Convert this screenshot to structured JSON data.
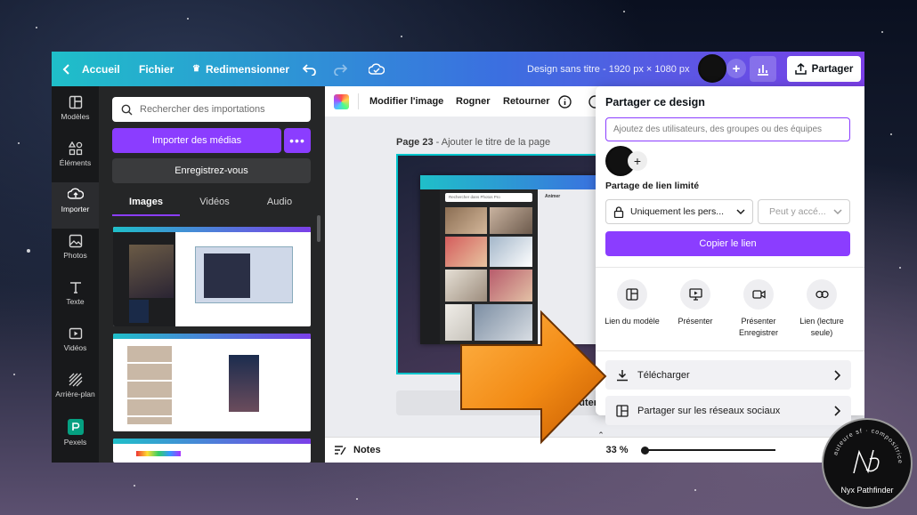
{
  "topbar": {
    "home_label": "Accueil",
    "file_label": "Fichier",
    "resize_label": "Redimensionner",
    "design_title": "Design sans titre - 1920 px × 1080 px",
    "share_label": "Partager"
  },
  "sidebar": {
    "items": [
      {
        "label": "Modèles",
        "icon": "templates-icon"
      },
      {
        "label": "Éléments",
        "icon": "elements-icon"
      },
      {
        "label": "Importer",
        "icon": "upload-icon"
      },
      {
        "label": "Photos",
        "icon": "photos-icon"
      },
      {
        "label": "Texte",
        "icon": "text-icon"
      },
      {
        "label": "Vidéos",
        "icon": "videos-icon"
      },
      {
        "label": "Arrière-plan",
        "icon": "background-icon"
      },
      {
        "label": "Pexels",
        "icon": "pexels-icon"
      }
    ]
  },
  "panel": {
    "search_placeholder": "Rechercher des importations",
    "import_button": "Importer des médias",
    "register_button": "Enregistrez-vous",
    "tabs": [
      "Images",
      "Vidéos",
      "Audio"
    ]
  },
  "toolbar": {
    "edit_image": "Modifier l'image",
    "crop": "Rogner",
    "flip": "Retourner"
  },
  "canvas": {
    "page_number": "Page 23",
    "page_title_placeholder": "- Ajouter le titre de la page",
    "notes_label": "Notes",
    "zoom": "33 %",
    "zoom_fraction": 0.33,
    "page_count": "23",
    "add_page_fragment": "uter"
  },
  "share_panel": {
    "title": "Partager ce design",
    "invite_placeholder": "Ajoutez des utilisateurs, des groupes ou des équipes",
    "restricted_title": "Partage de lien limité",
    "access_value": "Uniquement les pers...",
    "permission_value": "Peut y accé...",
    "copy_link": "Copier le lien",
    "options": [
      {
        "label": "Lien du modèle",
        "icon": "template-link-icon"
      },
      {
        "label": "Présenter",
        "icon": "present-icon"
      },
      {
        "label": "Présenter Enregistrer",
        "icon": "present-record-icon"
      },
      {
        "label": "Lien (lecture seule)",
        "icon": "link-icon"
      }
    ],
    "download": "Télécharger",
    "social": "Partager sur les réseaux sociaux"
  },
  "mini_ui": {
    "search_photos": "Rechercher dans Photos Pro",
    "animate": "Animer"
  },
  "watermark": {
    "name": "Nyx Pathfinder",
    "arc_text": "auteure sf · compositrice"
  },
  "colors": {
    "accent_purple": "#8b3dff",
    "topbar_start": "#1fbfc9",
    "topbar_end": "#7b3fe8",
    "arrow_orange": "#f28a14"
  }
}
